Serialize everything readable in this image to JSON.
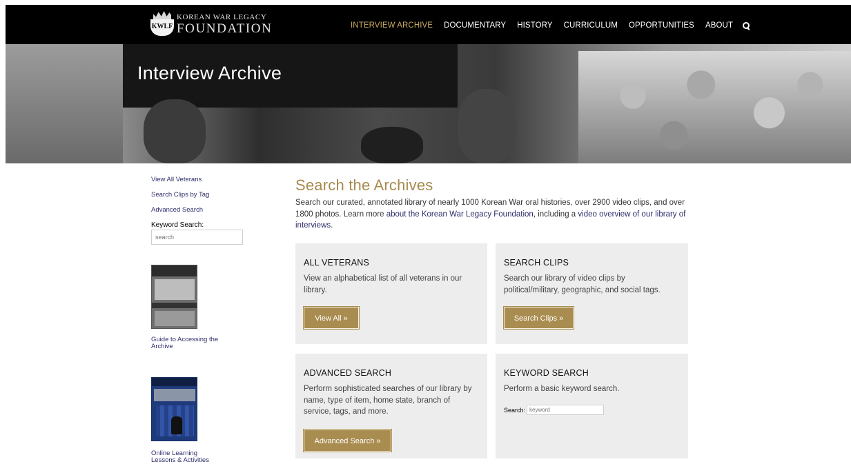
{
  "header": {
    "logo": {
      "badge_text": "KWLF",
      "line1": "KOREAN WAR LEGACY",
      "line2": "FOUNDATION"
    },
    "nav": [
      {
        "label": "INTERVIEW ARCHIVE",
        "active": true
      },
      {
        "label": "DOCUMENTARY"
      },
      {
        "label": "HISTORY"
      },
      {
        "label": "CURRICULUM"
      },
      {
        "label": "OPPORTUNITIES"
      },
      {
        "label": "ABOUT"
      }
    ],
    "search_icon": "search-icon"
  },
  "hero": {
    "title": "Interview Archive"
  },
  "sidebar": {
    "links": [
      "View All Veterans",
      "Search Clips by Tag",
      "Advanced Search"
    ],
    "keyword_label": "Keyword Search:",
    "keyword_placeholder": "search",
    "guide_caption": "Guide to Accessing the Archive",
    "online_caption": "Online Learning Lessons & Activities"
  },
  "main": {
    "title": "Search the Archives",
    "intro_text": "Search our curated, annotated library of nearly 1000 Korean War oral histories, over 2900 video clips, and over 1800 photos. Learn more ",
    "intro_link1": "about the Korean War Legacy Foundation",
    "intro_mid": ", including a ",
    "intro_link2": "video overview of our library of interviews",
    "intro_end": "."
  },
  "cards": {
    "all_veterans": {
      "title": "ALL VETERANS",
      "text": "View an alphabetical list of all veterans in our library.",
      "button": "View All »"
    },
    "search_clips": {
      "title": "SEARCH CLIPS",
      "text": "Search our library of video clips by political/military, geographic, and social tags.",
      "button": "Search Clips »"
    },
    "advanced_search": {
      "title": "ADVANCED SEARCH",
      "text": "Perform sophisticated searches of our library by name, type of item, home state, branch of service, tags, and more.",
      "button": "Advanced Search »"
    },
    "keyword_search": {
      "title": "KEYWORD SEARCH",
      "text": "Perform a basic keyword search.",
      "search_label": "Search:",
      "search_placeholder": "keyword"
    }
  },
  "colors": {
    "accent_gold": "#a98c4f",
    "nav_active": "#c9a95f",
    "link_navy": "#2c2c6a",
    "card_bg": "#ededed"
  }
}
